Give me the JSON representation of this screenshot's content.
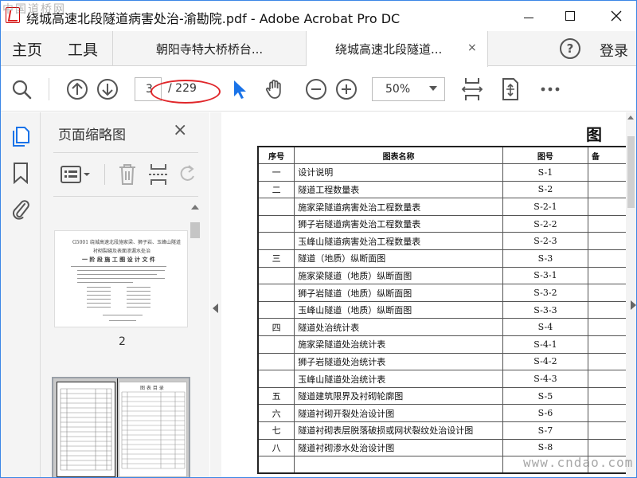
{
  "window": {
    "title": "绕城高速北段隧道病害处治-渝勘院.pdf - Adobe Acrobat Pro DC"
  },
  "nav": {
    "home": "主页",
    "tools": "工具",
    "login": "登录"
  },
  "tabs": [
    {
      "label": "朝阳寺特大桥桥台...",
      "active": false
    },
    {
      "label": "绕城高速北段隧道...",
      "active": true,
      "close": "×"
    }
  ],
  "toolbar": {
    "page_current": "3",
    "page_total": "/ 229",
    "zoom": "50%"
  },
  "panel": {
    "title": "页面缩略图",
    "close": "×",
    "thumbs": [
      {
        "label": "2",
        "lines": [
          "G5001 绕城高速北段施家梁、狮子岩、玉峰山隧道",
          "衬砌裂缝及表面渗漏水处治",
          "一 阶 段 施 工 图 设 计 文 件"
        ]
      },
      {
        "heading": "图 表 目 录"
      }
    ]
  },
  "document": {
    "heading": "图",
    "columns": [
      "序号",
      "图表名称",
      "图号",
      "备"
    ],
    "rows": [
      {
        "no": "一",
        "name": "设计说明",
        "code": "S-1"
      },
      {
        "no": "二",
        "name": "隧道工程数量表",
        "code": "S-2"
      },
      {
        "no": "",
        "name": "施家梁隧道病害处治工程数量表",
        "code": "S-2-1"
      },
      {
        "no": "",
        "name": "狮子岩隧道病害处治工程数量表",
        "code": "S-2-2"
      },
      {
        "no": "",
        "name": "玉峰山隧道病害处治工程数量表",
        "code": "S-2-3"
      },
      {
        "no": "三",
        "name": "隧道（地质）纵断面图",
        "code": "S-3"
      },
      {
        "no": "",
        "name": "施家梁隧道（地质）纵断面图",
        "code": "S-3-1"
      },
      {
        "no": "",
        "name": "狮子岩隧道（地质）纵断面图",
        "code": "S-3-2"
      },
      {
        "no": "",
        "name": "玉峰山隧道（地质）纵断面图",
        "code": "S-3-3"
      },
      {
        "no": "四",
        "name": "隧道处治统计表",
        "code": "S-4"
      },
      {
        "no": "",
        "name": "施家梁隧道处治统计表",
        "code": "S-4-1"
      },
      {
        "no": "",
        "name": "狮子岩隧道处治统计表",
        "code": "S-4-2"
      },
      {
        "no": "",
        "name": "玉峰山隧道处治统计表",
        "code": "S-4-3"
      },
      {
        "no": "五",
        "name": "隧道建筑限界及衬砌轮廓图",
        "code": "S-5"
      },
      {
        "no": "六",
        "name": "隧道衬砌开裂处治设计图",
        "code": "S-6"
      },
      {
        "no": "七",
        "name": "隧道衬砌表层脱落破损或网状裂纹处治设计图",
        "code": "S-7"
      },
      {
        "no": "八",
        "name": "隧道衬砌渗水处治设计图",
        "code": "S-8"
      },
      {
        "no": "",
        "name": "",
        "code": ""
      }
    ]
  },
  "watermarks": {
    "top": "中国道桥网",
    "bottom": "www.cndao.com"
  },
  "colors": {
    "annotation_ellipse": "#e0262a",
    "select_tool_active": "#1a73e8",
    "window_border": "#3b86e6"
  },
  "icons": {
    "left_rail": [
      "page-thumbnails-icon",
      "bookmark-icon",
      "attachment-icon"
    ],
    "toolbar": [
      "search-icon",
      "page-up-icon",
      "page-down-icon",
      "select-tool-icon",
      "hand-tool-icon",
      "zoom-out-icon",
      "zoom-in-icon",
      "fit-page-icon",
      "page-scroll-icon",
      "more-icon"
    ],
    "panel_tools": [
      "thumbnail-options-icon",
      "delete-page-icon",
      "insert-page-icon",
      "rotate-page-icon"
    ]
  }
}
